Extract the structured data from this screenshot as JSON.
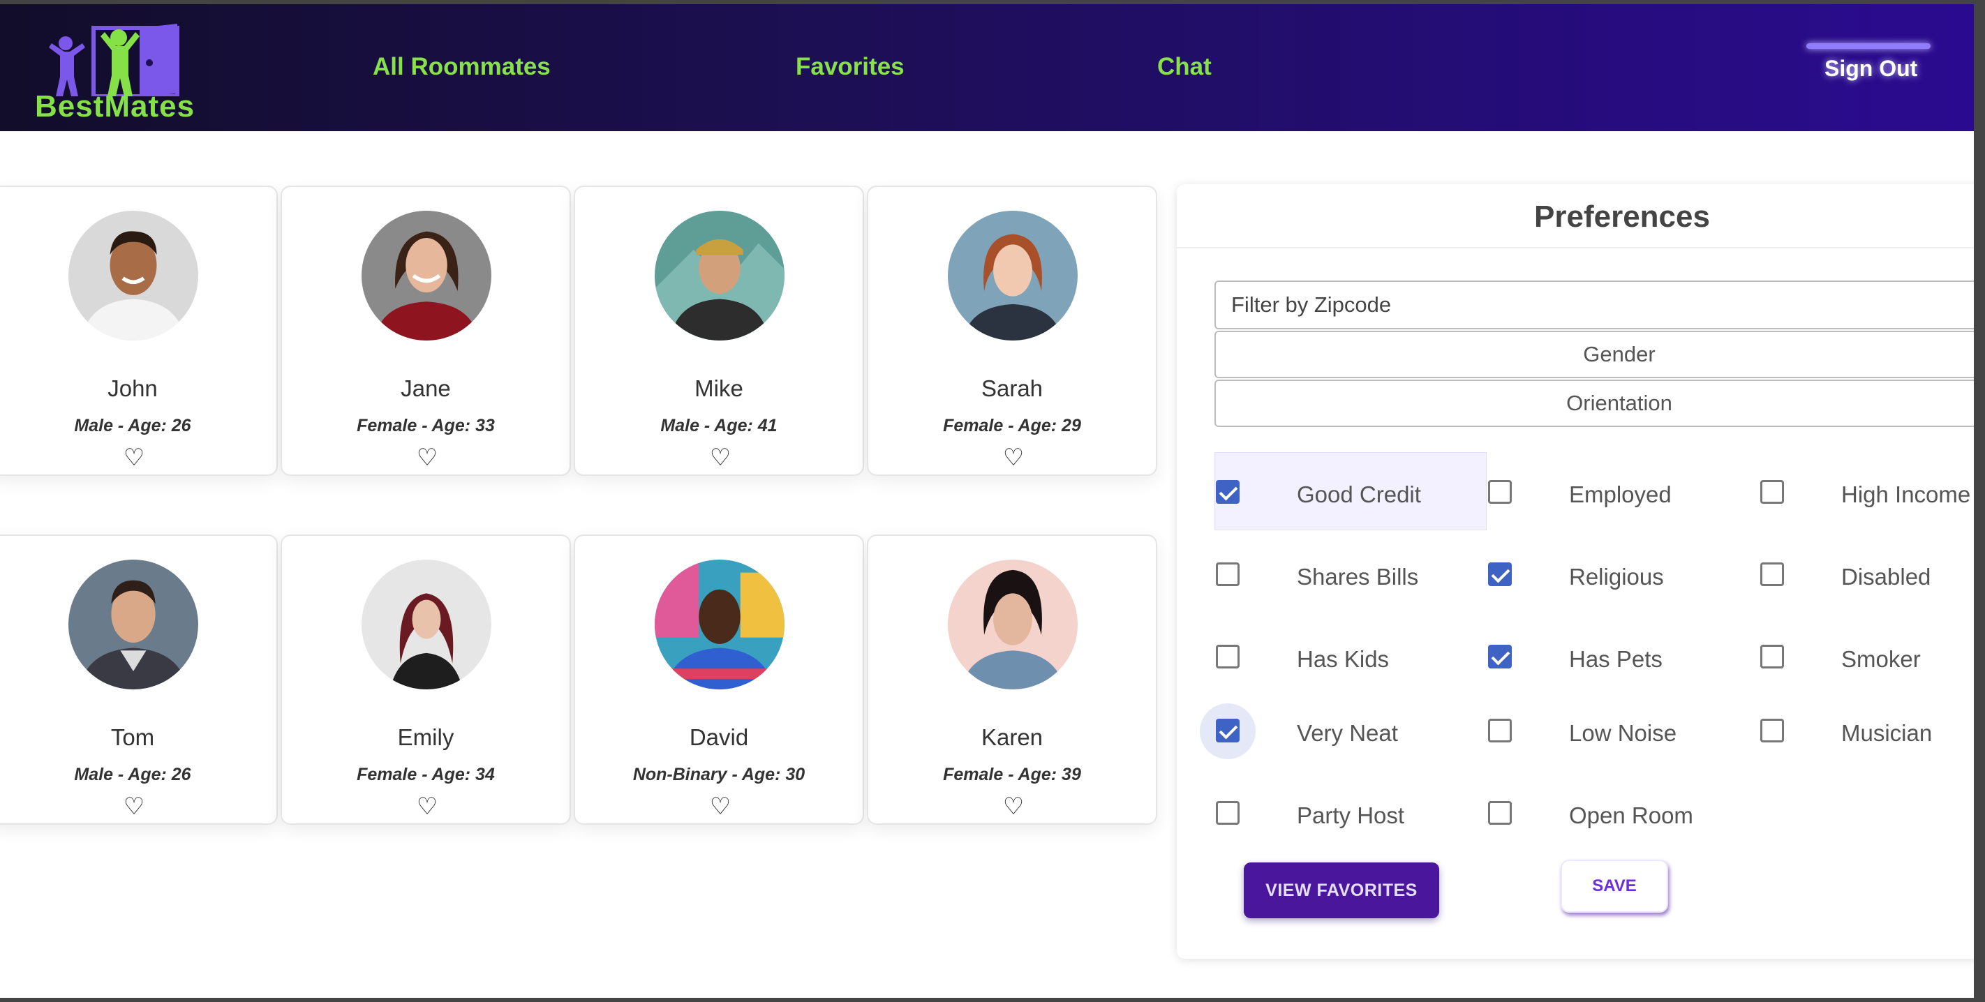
{
  "brand": {
    "name": "BestMates",
    "accent": "#88e04a",
    "primary": "#4a169c"
  },
  "nav": {
    "all_roommates": "All Roommates",
    "favorites": "Favorites",
    "chat": "Chat",
    "sign_out": "Sign Out"
  },
  "roommates": [
    {
      "name": "John",
      "info": "Male - Age: 26",
      "avatar": "photo-john",
      "favorited": false
    },
    {
      "name": "Jane",
      "info": "Female - Age: 33",
      "avatar": "photo-jane",
      "favorited": false
    },
    {
      "name": "Mike",
      "info": "Male - Age: 41",
      "avatar": "photo-mike",
      "favorited": false
    },
    {
      "name": "Sarah",
      "info": "Female - Age: 29",
      "avatar": "photo-sarah",
      "favorited": false
    },
    {
      "name": "Tom",
      "info": "Male - Age: 26",
      "avatar": "photo-tom",
      "favorited": false
    },
    {
      "name": "Emily",
      "info": "Female - Age: 34",
      "avatar": "photo-emily",
      "favorited": false
    },
    {
      "name": "David",
      "info": "Non-Binary - Age: 30",
      "avatar": "photo-david",
      "favorited": false
    },
    {
      "name": "Karen",
      "info": "Female - Age: 39",
      "avatar": "photo-karen",
      "favorited": false
    }
  ],
  "heart_glyph": "♡",
  "preferences": {
    "title": "Preferences",
    "zip_placeholder": "Filter by Zipcode",
    "zip_value": "",
    "gender_label": "Gender",
    "orientation_label": "Orientation",
    "options": [
      {
        "label": "Good Credit",
        "checked": true
      },
      {
        "label": "Employed",
        "checked": false
      },
      {
        "label": "High Income",
        "checked": false
      },
      {
        "label": "Shares Bills",
        "checked": false
      },
      {
        "label": "Religious",
        "checked": true
      },
      {
        "label": "Disabled",
        "checked": false
      },
      {
        "label": "Has Kids",
        "checked": false
      },
      {
        "label": "Has Pets",
        "checked": true
      },
      {
        "label": "Smoker",
        "checked": false
      },
      {
        "label": "Very Neat",
        "checked": true
      },
      {
        "label": "Low Noise",
        "checked": false
      },
      {
        "label": "Musician",
        "checked": false
      },
      {
        "label": "Party Host",
        "checked": false
      },
      {
        "label": "Open Room",
        "checked": false
      }
    ],
    "view_favorites_label": "VIEW FAVORITES",
    "save_label": "SAVE"
  }
}
